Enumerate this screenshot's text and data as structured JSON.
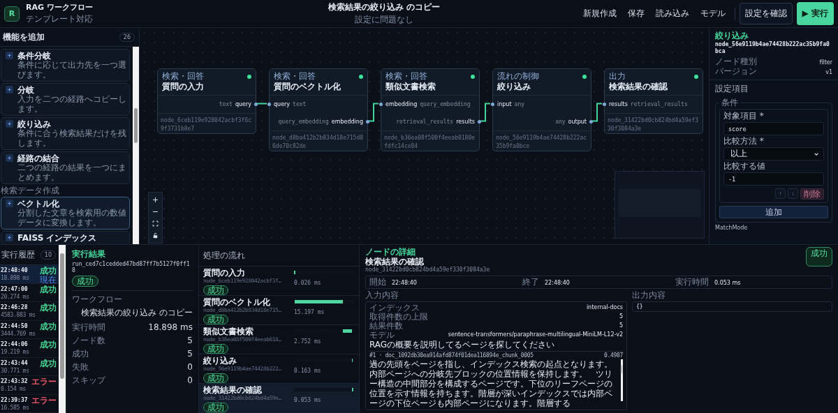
{
  "header": {
    "logo": "R",
    "title": "RAG ワークフロー",
    "subtitle": "テンプレート対応",
    "doc_title": "検索結果の絞り込み のコピー",
    "doc_status": "設定に問題なし",
    "menu": [
      "新規作成",
      "保存",
      "読み込み",
      "モデル"
    ],
    "check_button": "設定を確認",
    "run_button": "▶ 実行"
  },
  "sidebar": {
    "title": "機能を追加",
    "count": "26",
    "groups": [
      {
        "items": [
          {
            "title": "条件分岐",
            "description": "条件に応じて出力先を一つ選びます。",
            "selected": false
          },
          {
            "title": "分岐",
            "description": "入力を二つの経路へコピーします。",
            "selected": false
          },
          {
            "title": "絞り込み",
            "description": "条件に合う検索結果だけを残します。",
            "selected": false
          },
          {
            "title": "経路の結合",
            "description": "二つの経路の結果を一つにまとめます。",
            "selected": false
          }
        ]
      },
      {
        "label": "検索データ作成",
        "items": [
          {
            "title": "ベクトル化",
            "description": "分割した文章を検索用の数値データに変換します。",
            "selected": true
          },
          {
            "title": "FAISS インデックス",
            "selected": false
          }
        ]
      }
    ]
  },
  "canvas": {
    "nodes": [
      {
        "category": "検索・回答",
        "title": "質問の入力",
        "outputs": [
          {
            "name": "query",
            "type": "text"
          }
        ],
        "id": "node_6ceb119e928042acbf3f6c9f3731b8e7"
      },
      {
        "category": "検索・回答",
        "title": "質問のベクトル化",
        "inputs": [
          {
            "name": "query",
            "type": "text"
          }
        ],
        "outputs": [
          {
            "name": "embedding",
            "type": "query_embedding"
          }
        ],
        "id": "node_d8ba412b2b834d18e715d86de70c82de"
      },
      {
        "category": "検索・回答",
        "title": "類似文書検索",
        "inputs": [
          {
            "name": "embedding",
            "type": "query_embedding"
          }
        ],
        "outputs": [
          {
            "name": "results",
            "type": "retrieval_results"
          }
        ],
        "id": "node_b36ea08f500f4eeab0180efdfc14ce84"
      },
      {
        "category": "流れの制御",
        "title": "絞り込み",
        "inputs": [
          {
            "name": "input",
            "type": "any"
          }
        ],
        "outputs": [
          {
            "name": "output",
            "type": "any"
          }
        ],
        "id": "node_56e9119b4ae74428b222ac35b9fa0bce"
      },
      {
        "category": "出力",
        "title": "検索結果の確認",
        "inputs": [
          {
            "name": "results",
            "type": "retrieval_results"
          }
        ],
        "id": "node_31422bd0cb824bd4a59ef330f3084a3e"
      }
    ]
  },
  "inspector": {
    "category": "絞り込み",
    "node_id": "node_56e9119b4ae74428b222ac35b9fa0bca",
    "props": [
      {
        "label": "ノード種別",
        "value": "filter"
      },
      {
        "label": "バージョン",
        "value": "v1"
      }
    ],
    "section": "設定項目",
    "group_legend": "条件",
    "fields": [
      {
        "kind": "input",
        "label": "対象項目 *",
        "value": "score"
      },
      {
        "kind": "select",
        "label": "比較方法 *",
        "value": "以上"
      },
      {
        "kind": "input",
        "label": "比較する値",
        "value": "-1"
      }
    ],
    "row_buttons": [
      "↑",
      "↓"
    ],
    "delete_button": "削除",
    "add_button": "追加",
    "next_label": "MatchMode"
  },
  "history": {
    "title": "実行履歴",
    "count": "10",
    "runs": [
      {
        "time": "22:48:40",
        "duration": "18.898 ms",
        "status": "成功",
        "error": false,
        "tag": "現在",
        "selected": true
      },
      {
        "time": "22:47:00",
        "duration": "20.274 ms",
        "status": "成功",
        "error": false,
        "selected": false
      },
      {
        "time": "22:46:28",
        "duration": "4583.883 ms",
        "status": "成功",
        "error": false,
        "selected": false
      },
      {
        "time": "22:44:50",
        "duration": "3444.769 ms",
        "status": "成功",
        "error": false,
        "selected": false
      },
      {
        "time": "22:44:06",
        "duration": "19.219 ms",
        "status": "成功",
        "error": false,
        "selected": false
      },
      {
        "time": "22:43:44",
        "duration": "30.771 ms",
        "status": "成功",
        "error": false,
        "selected": false
      },
      {
        "time": "22:43:32",
        "duration": "0.154 ms",
        "status": "エラー",
        "error": true,
        "selected": false
      },
      {
        "time": "22:39:37",
        "duration": "16.585 ms",
        "status": "エラー",
        "error": true,
        "selected": false
      }
    ]
  },
  "run_result": {
    "title": "実行結果",
    "run_id": "run_ced7c1cedded47bd87ff7b5127f0ff18",
    "status": "成功",
    "rows": [
      {
        "label": "ワークフロー",
        "value": "検索結果の絞り込み のコピー"
      },
      {
        "label": "実行時間",
        "value": "18.898 ms"
      },
      {
        "label": "ノード数",
        "value": "5"
      },
      {
        "label": "成功",
        "value": "5"
      },
      {
        "label": "失敗",
        "value": "0"
      },
      {
        "label": "スキップ",
        "value": "0"
      }
    ]
  },
  "flow": {
    "title": "処理の流れ",
    "steps": [
      {
        "name": "質問の入力",
        "node_id": "node_6ceb119e928042acbf3f…",
        "status": "成功",
        "level": 0.006,
        "duration": "0.026 ms",
        "selected": false
      },
      {
        "name": "質問のベクトル化",
        "node_id": "node_d8ba412b2b834d18e715…",
        "status": "成功",
        "level": 0.8,
        "duration": "15.197 ms",
        "selected": false
      },
      {
        "name": "類似文書検索",
        "node_id": "node_b36ea08f500f4eeab018…",
        "status": "成功",
        "level": 0.145,
        "duration": "2.752 ms",
        "selected": false
      },
      {
        "name": "絞り込み",
        "node_id": "node_56e9119b4ae74428b222…",
        "status": "成功",
        "level": 0.008,
        "duration": "0.163 ms",
        "selected": false
      },
      {
        "name": "検索結果の確認",
        "node_id": "node_31422bd0cb824bd4a59e…",
        "status": "成功",
        "level": 0.006,
        "duration": "0.053 ms",
        "selected": true
      }
    ]
  },
  "detail": {
    "title": "ノードの詳細",
    "name": "検索結果の確認",
    "node_id": "node_31422bd0cb824bd4a59ef330f3084a3e",
    "status": "成功",
    "timing": [
      {
        "label": "開始",
        "value": "22:48:40"
      },
      {
        "label": "終了",
        "value": "22:48:40"
      },
      {
        "label": "実行時間",
        "value": "0.053 ms"
      }
    ],
    "input_label": "入力内容",
    "output_label": "出力内容",
    "input_rows": [
      {
        "label": "インデックス",
        "value": "internal-docs"
      },
      {
        "label": "取得件数の上限",
        "value": "5"
      },
      {
        "label": "結果件数",
        "value": "5"
      },
      {
        "label": "モデル",
        "value": "sentence-transformers/paraphrase-multilingual-MiniLM-L12-v2"
      }
    ],
    "query": "RAGの概要を説明してるページを探してください",
    "result": {
      "rank": "#1 · doc_1092db30ea914afd874f01dea116894e_chunk_0005",
      "score": "0.4987",
      "text": "過の先頭をページを指し、インデックス検索の起点となります。内部ページへの分岐先ブロックの位置情報を保持します。　ツリー構造の中間部分を構成するページです。下位のリーフページの位置を示す情報を持ちます。階層が深いインデックスでは内部ページの下位ページも内部ページになります。階層する"
    },
    "output": "{}"
  }
}
